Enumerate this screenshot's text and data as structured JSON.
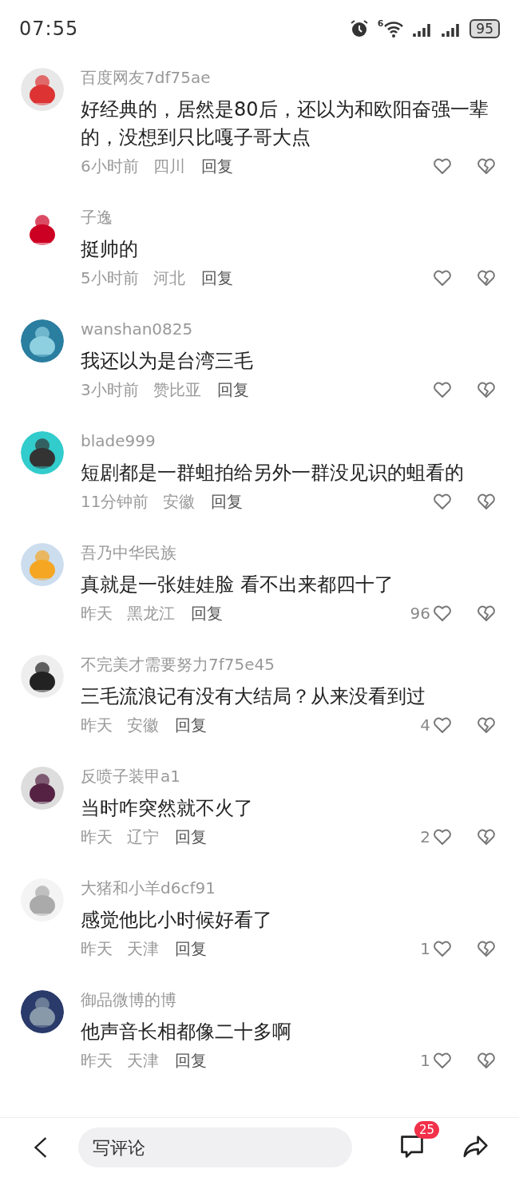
{
  "status_bar": {
    "time": "07:55",
    "wifi_label": "6",
    "battery": "95"
  },
  "comments": [
    {
      "user": "百度网友7df75ae",
      "text": "好经典的，居然是80后，还以为和欧阳奋强一辈的，没想到只比嘎子哥大点",
      "time": "6小时前",
      "location": "四川",
      "reply": "回复"
    },
    {
      "user": "子逸",
      "text": "挺帅的",
      "time": "5小时前",
      "location": "河北",
      "reply": "回复"
    },
    {
      "user": "wanshan0825",
      "text": "我还以为是台湾三毛",
      "time": "3小时前",
      "location": "赞比亚",
      "reply": "回复"
    },
    {
      "user": "blade999",
      "text": "短剧都是一群蛆拍给另外一群没见识的蛆看的",
      "time": "11分钟前",
      "location": "安徽",
      "reply": "回复"
    },
    {
      "user": "吾乃中华民族",
      "text": "真就是一张娃娃脸 看不出来都四十了",
      "time": "昨天",
      "location": "黑龙江",
      "reply": "回复",
      "likes": "96"
    },
    {
      "user": "不完美才需要努力7f75e45",
      "text": "三毛流浪记有没有大结局？从来没看到过",
      "time": "昨天",
      "location": "安徽",
      "reply": "回复",
      "likes": "4"
    },
    {
      "user": "反喷子装甲a1",
      "text": "当时咋突然就不火了",
      "time": "昨天",
      "location": "辽宁",
      "reply": "回复",
      "likes": "2"
    },
    {
      "user": "大猪和小羊d6cf91",
      "text": "感觉他比小时候好看了",
      "time": "昨天",
      "location": "天津",
      "reply": "回复",
      "likes": "1"
    },
    {
      "user": "御品微博的博",
      "text": "他声音长相都像二十多啊",
      "time": "昨天",
      "location": "天津",
      "reply": "回复",
      "likes": "1"
    }
  ],
  "bottom_bar": {
    "placeholder": "写评论",
    "comment_count": "25"
  }
}
